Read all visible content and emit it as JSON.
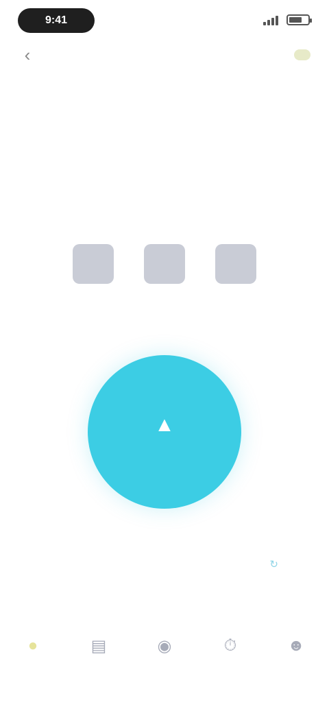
{
  "status_bar": {
    "time": "9:41",
    "battery_level": 0.7
  },
  "header": {
    "back_icon": "back-arrow-icon",
    "title": "",
    "action_icon": "crown-icon"
  },
  "sub_bar": {
    "left_text": "",
    "right_text": ""
  },
  "timer": {
    "units": [
      {
        "value": "",
        "label": ""
      },
      {
        "value": "",
        "label": ""
      },
      {
        "value": "",
        "label": ""
      }
    ]
  },
  "start_button": {
    "icon": "flame-icon",
    "label": ""
  },
  "history_link": {
    "icon": "history-icon",
    "label": ""
  },
  "bottom_nav": {
    "items": [
      {
        "icon": "home-icon",
        "label": "",
        "active": true
      },
      {
        "icon": "chart-icon",
        "label": "",
        "active": false
      },
      {
        "icon": "bulb-icon",
        "label": "",
        "active": false
      },
      {
        "icon": "timer-icon",
        "label": "",
        "active": false
      },
      {
        "icon": "user-icon",
        "label": "",
        "active": false
      }
    ]
  },
  "colors": {
    "accent": "#3ccde4",
    "active_nav": "#e6e39a",
    "link": "#8fd4e6"
  }
}
